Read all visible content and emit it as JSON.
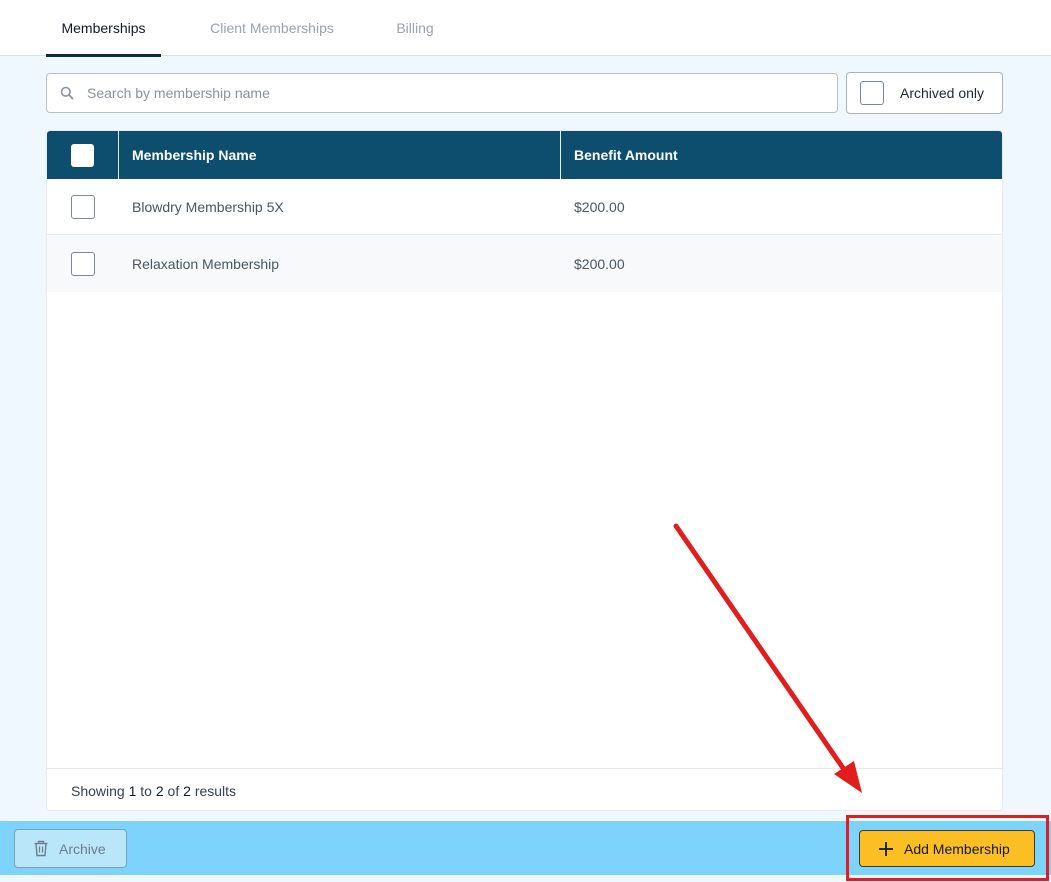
{
  "tabs": [
    {
      "label": "Memberships",
      "active": true
    },
    {
      "label": "Client Memberships",
      "active": false
    },
    {
      "label": "Billing",
      "active": false
    }
  ],
  "search": {
    "placeholder": "Search by membership name",
    "value": ""
  },
  "archived_filter": {
    "label": "Archived only",
    "checked": false
  },
  "table": {
    "columns": [
      "Membership Name",
      "Benefit Amount"
    ],
    "rows": [
      {
        "name": "Blowdry Membership 5X",
        "benefit": "$200.00"
      },
      {
        "name": "Relaxation Membership",
        "benefit": "$200.00"
      }
    ]
  },
  "pagination": {
    "prefix": "Showing",
    "from": "1",
    "to_word": "to",
    "to": "2",
    "of_word": "of",
    "total": "2",
    "suffix": "results"
  },
  "actions": {
    "archive_label": "Archive",
    "add_label": "Add Membership"
  },
  "colors": {
    "header_bg": "#0d4e6e",
    "action_bar_bg": "#7dd3fc",
    "add_button_bg": "#fbbf24",
    "annotation_red": "#e11d1d"
  }
}
